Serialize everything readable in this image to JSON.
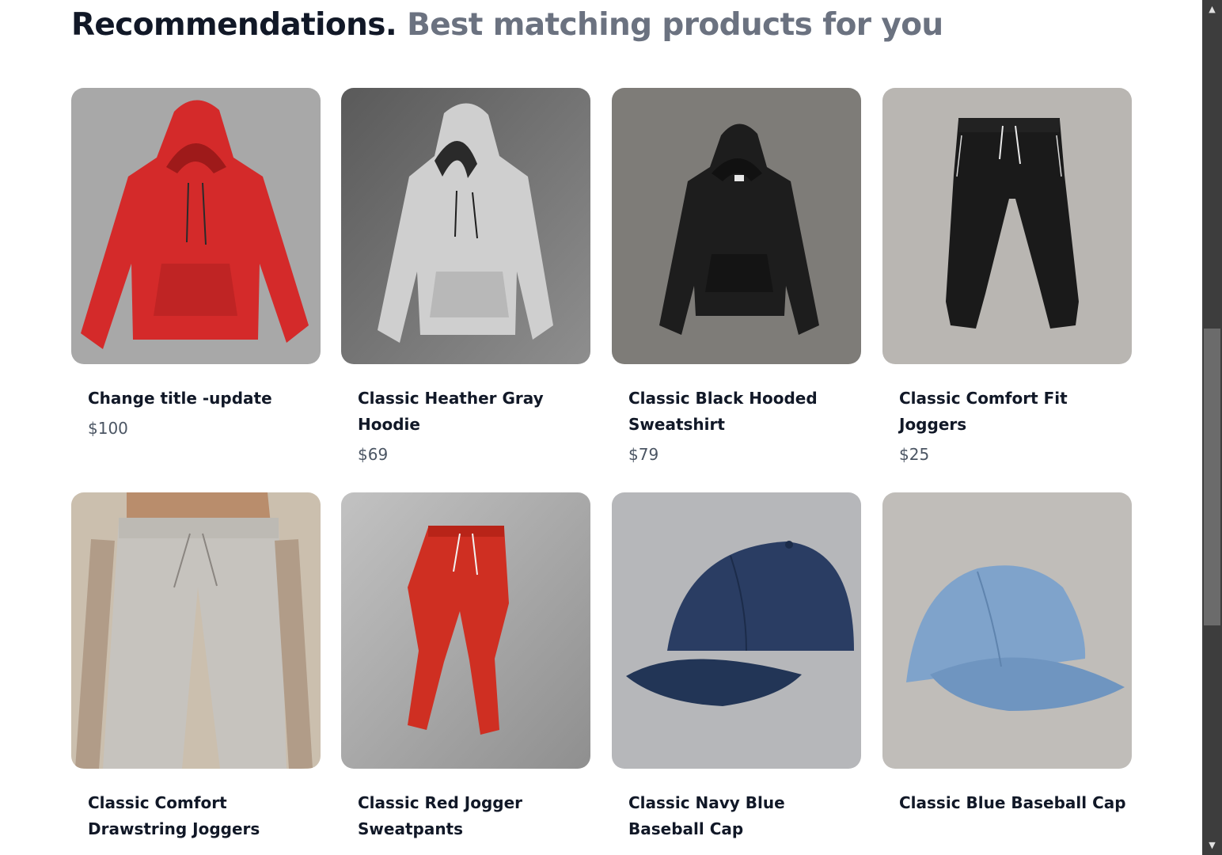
{
  "header": {
    "title": "Recommendations.",
    "subtitle": "Best matching products for you"
  },
  "products": [
    {
      "name": "Change title -update",
      "price": "$100",
      "image": "red-hoodie",
      "bg": "#a9a9a9",
      "color": "#d42a2a"
    },
    {
      "name": "Classic Heather Gray Hoodie",
      "price": "$69",
      "image": "gray-hoodie",
      "bg": "#7b7b7b",
      "color": "#cfcfcf"
    },
    {
      "name": "Classic Black Hooded Sweatshirt",
      "price": "$79",
      "image": "black-hoodie",
      "bg": "#7f7d79",
      "color": "#1d1d1d"
    },
    {
      "name": "Classic Comfort Fit Joggers",
      "price": "$25",
      "image": "black-joggers",
      "bg": "#b9b6b2",
      "color": "#1a1a1a"
    },
    {
      "name": "Classic Comfort Drawstring Joggers",
      "price": "",
      "image": "gray-joggers-worn",
      "bg": "#cbbfae",
      "color": "#c6c3be"
    },
    {
      "name": "Classic Red Jogger Sweatpants",
      "price": "",
      "image": "red-joggers",
      "bg": "#a4a4a4",
      "color": "#cf2f22"
    },
    {
      "name": "Classic Navy Blue Baseball Cap",
      "price": "",
      "image": "navy-cap",
      "bg": "#b6b7ba",
      "color": "#2a3d63"
    },
    {
      "name": "Classic Blue Baseball Cap",
      "price": "",
      "image": "blue-cap",
      "bg": "#c0bdb9",
      "color": "#7fa3cb"
    }
  ],
  "scrollbar": {
    "up_icon": "scroll-up-arrow-icon",
    "down_icon": "scroll-down-arrow-icon"
  }
}
